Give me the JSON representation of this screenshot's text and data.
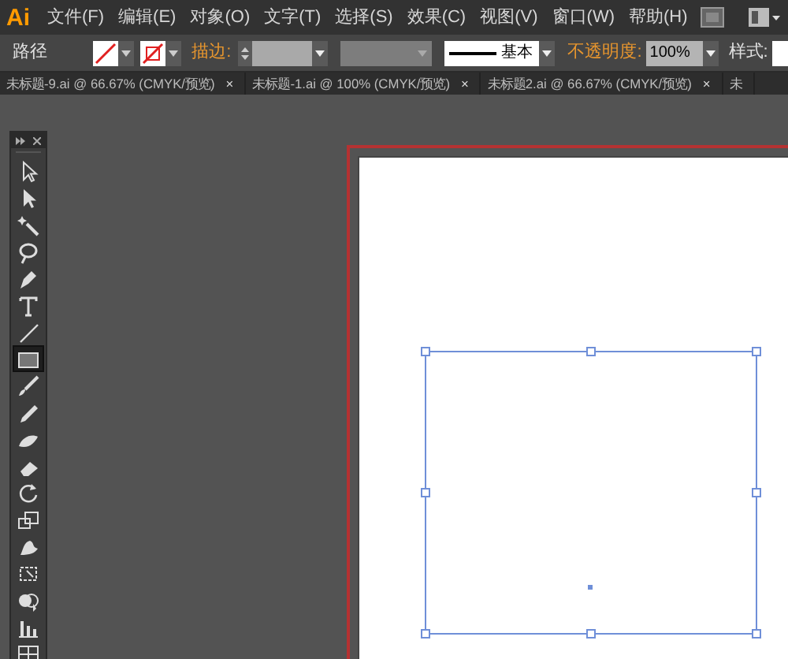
{
  "app_logo": "Ai",
  "menu": [
    "文件(F)",
    "编辑(E)",
    "对象(O)",
    "文字(T)",
    "选择(S)",
    "效果(C)",
    "视图(V)",
    "窗口(W)",
    "帮助(H)"
  ],
  "control_bar": {
    "object_type": "路径",
    "stroke_label": "描边:",
    "stroke_style": "基本",
    "opacity_label": "不透明度:",
    "opacity": "100%",
    "style_label": "样式:"
  },
  "tabs": [
    {
      "label": "未标题-9.ai @ 66.67% (CMYK/预览)",
      "close": "×"
    },
    {
      "label": "未标题-1.ai @ 100% (CMYK/预览)",
      "close": "×"
    },
    {
      "label": "未标题2.ai @ 66.67% (CMYK/预览)",
      "close": "×"
    },
    {
      "label": "未"
    }
  ],
  "tools": [
    {
      "selected": false
    },
    {
      "selected": false
    },
    {
      "selected": false
    },
    {
      "selected": false
    },
    {
      "selected": false
    },
    {
      "selected": false
    },
    {
      "selected": false
    },
    {
      "selected": true
    },
    {
      "selected": false
    },
    {
      "selected": false
    },
    {
      "selected": false
    },
    {
      "selected": false
    },
    {
      "selected": false
    },
    {
      "selected": false
    },
    {
      "selected": false
    },
    {
      "selected": false
    },
    {
      "selected": false
    },
    {
      "selected": false
    },
    {
      "selected": false
    }
  ]
}
